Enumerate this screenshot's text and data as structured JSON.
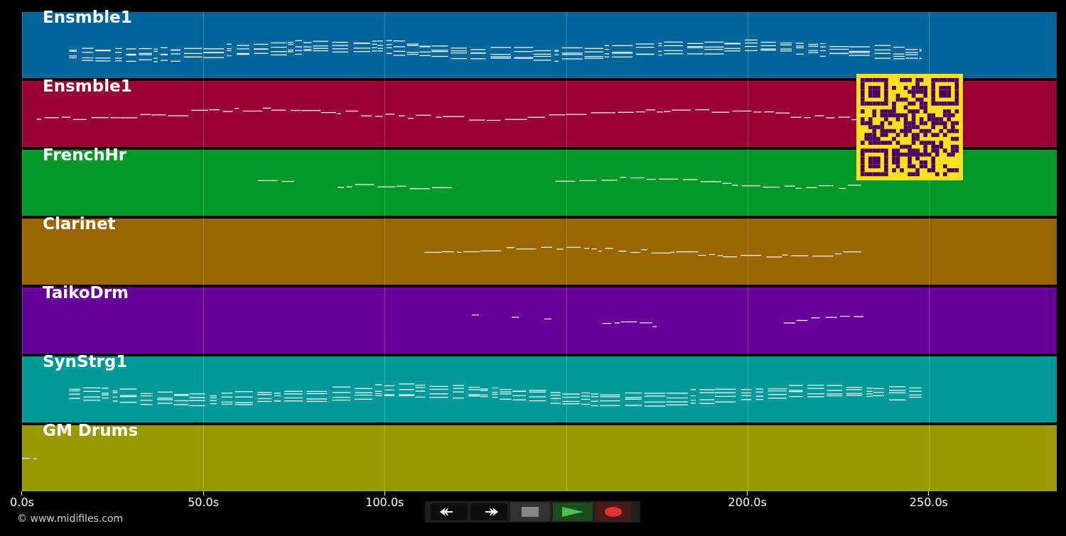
{
  "tracks": [
    {
      "name": "Ensmble1",
      "color": "#006699"
    },
    {
      "name": "Ensmble1",
      "color": "#990033"
    },
    {
      "name": "FrenchHr",
      "color": "#009928"
    },
    {
      "name": "Clarinet",
      "color": "#996600"
    },
    {
      "name": "TaikoDrm",
      "color": "#660099"
    },
    {
      "name": "SynStrg1",
      "color": "#009999"
    },
    {
      "name": "GM Drums",
      "color": "#999900"
    }
  ],
  "time_axis": {
    "ticks": [
      "0.0s",
      "50.0s",
      "100.0s",
      "200.0s",
      "250.0s"
    ]
  },
  "copyright": "© www.midifiles.com"
}
